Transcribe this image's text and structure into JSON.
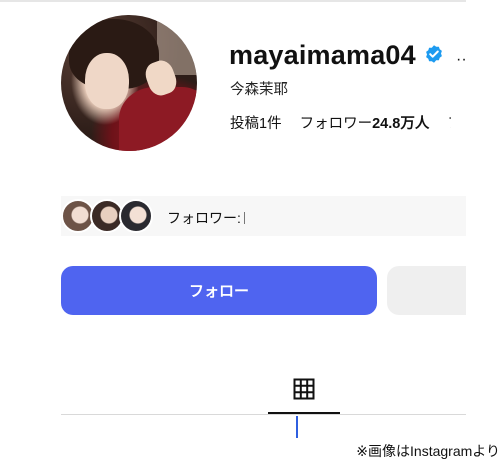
{
  "profile": {
    "username": "mayaimama04",
    "full_name": "今森茉耶",
    "verified": true,
    "more_glyph": "··",
    "stats": {
      "posts_label": "投稿",
      "posts_count": "1件",
      "followers_label": "フォロワー",
      "followers_count": "24.8万人",
      "following_partial": "フ"
    }
  },
  "followed_by": {
    "label": "フォロワー:"
  },
  "actions": {
    "follow_label": "フォロー"
  },
  "tabs": {
    "active": "grid-icon"
  },
  "credit": "※画像はInstagramより",
  "colors": {
    "accent": "#4f64f0",
    "verified": "#1d9bf0",
    "secondary_button": "#efefef"
  }
}
